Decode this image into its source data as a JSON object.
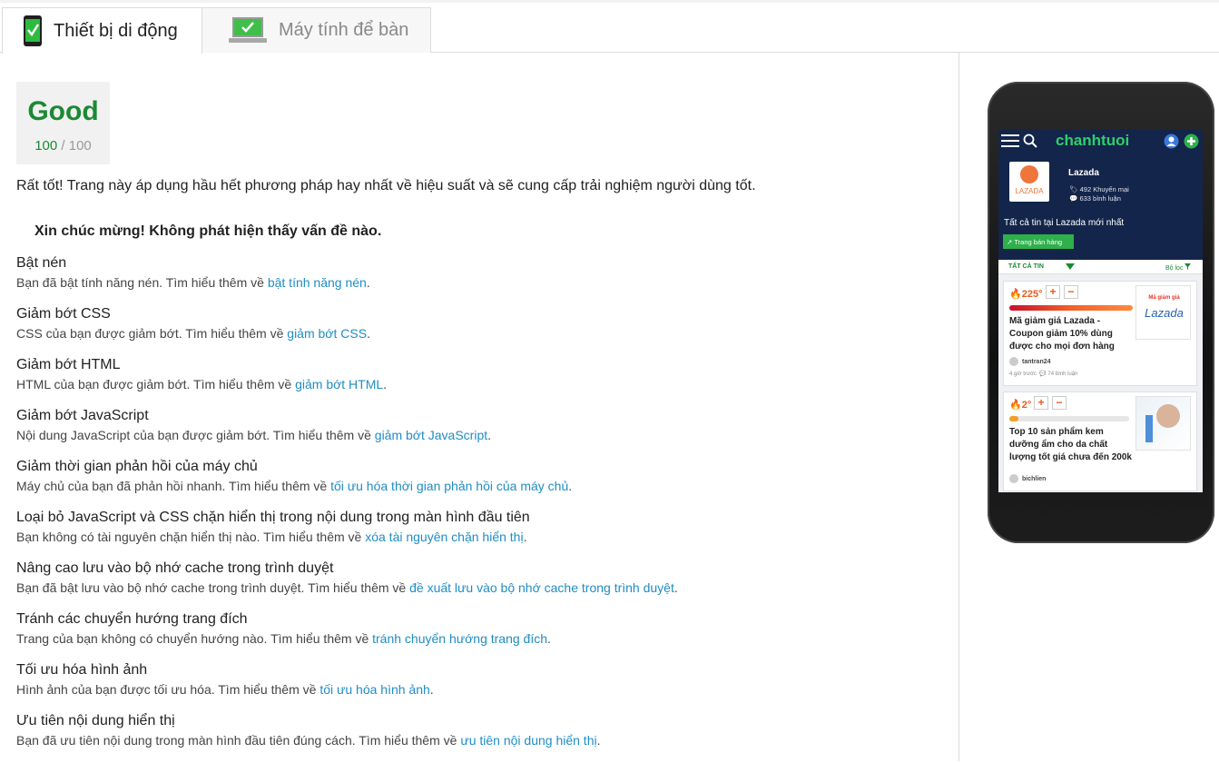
{
  "tabs": [
    {
      "label": "Thiết bị di động",
      "icon": "mobile-check-icon",
      "active": true
    },
    {
      "label": "Máy tính để bàn",
      "icon": "desktop-check-icon",
      "active": false
    }
  ],
  "score": {
    "label": "Good",
    "value": "100",
    "max": "/ 100",
    "color": "#1b8a33"
  },
  "summary": "Rất tốt! Trang này áp dụng hầu hết phương pháp hay nhất về hiệu suất và sẽ cung cấp trải nghiệm người dùng tốt.",
  "congrats": "Xin chúc mừng! Không phát hiện thấy vấn đề nào.",
  "rules": [
    {
      "title": "Bật nén",
      "desc": "Bạn đã bật tính năng nén. Tìm hiểu thêm về ",
      "link": "bật tính năng nén"
    },
    {
      "title": "Giảm bớt CSS",
      "desc": "CSS của bạn được giảm bớt. Tìm hiểu thêm về ",
      "link": "giảm bớt CSS"
    },
    {
      "title": "Giảm bớt HTML",
      "desc": "HTML của bạn được giảm bớt. Tìm hiểu thêm về ",
      "link": "giảm bớt HTML"
    },
    {
      "title": "Giảm bớt JavaScript",
      "desc": "Nội dung JavaScript của bạn được giảm bớt. Tìm hiểu thêm về ",
      "link": "giảm bớt JavaScript"
    },
    {
      "title": "Giảm thời gian phản hồi của máy chủ",
      "desc": "Máy chủ của bạn đã phản hồi nhanh. Tìm hiểu thêm về ",
      "link": "tối ưu hóa thời gian phản hồi của máy chủ"
    },
    {
      "title": "Loại bỏ JavaScript và CSS chặn hiển thị trong nội dung trong màn hình đầu tiên",
      "desc": "Bạn không có tài nguyên chặn hiển thị nào. Tìm hiểu thêm về ",
      "link": "xóa tài nguyên chặn hiển thị"
    },
    {
      "title": "Nâng cao lưu vào bộ nhớ cache trong trình duyệt",
      "desc": "Bạn đã bật lưu vào bộ nhớ cache trong trình duyệt. Tìm hiểu thêm về ",
      "link": "đề xuất lưu vào bộ nhớ cache trong trình duyệt"
    },
    {
      "title": "Tránh các chuyển hướng trang đích",
      "desc": "Trang của bạn không có chuyển hướng nào. Tìm hiểu thêm về ",
      "link": "tránh chuyển hướng trang đích"
    },
    {
      "title": "Tối ưu hóa hình ảnh",
      "desc": "Hình ảnh của bạn được tối ưu hóa. Tìm hiểu thêm về ",
      "link": "tối ưu hóa hình ảnh"
    },
    {
      "title": "Ưu tiên nội dung hiển thị",
      "desc": "Bạn đã ưu tiên nội dung trong màn hình đầu tiên đúng cách. Tìm hiểu thêm về ",
      "link": "ưu tiên nội dung hiển thị"
    }
  ],
  "preview": {
    "logo": "chanhtuoi",
    "store_logo_text": "LAZADA",
    "store_name": "Lazada",
    "promos": "492 Khuyến mại",
    "comments": "633 bình luận",
    "all_news": "Tất cả tin tại Lazada mới nhất",
    "store_button": "Trang bán hàng",
    "filter_left": "TẤT CẢ TIN",
    "filter_right": "Bộ lọc",
    "cards": [
      {
        "hot": "225°",
        "heat": 1.0,
        "title": "Mã giảm giá Lazada - Coupon giảm 10% dùng được cho mọi đơn hàng",
        "thumb_caption": "Mã giảm giá",
        "thumb_brand": "Lazada",
        "user": "tantran24",
        "ago": "4 giờ trước",
        "comment_count": "74 bình luận"
      },
      {
        "hot": "2°",
        "heat": 0.05,
        "title": "Top 10 sản phẩm kem dưỡng ẩm cho da chất lượng tốt giá chưa đến 200k",
        "user": "bichlien"
      }
    ]
  },
  "colors": {
    "good": "#1b8a33",
    "link": "#1f8dc4",
    "phone_nav": "#13254a",
    "brand_green": "#2fcf6a"
  }
}
